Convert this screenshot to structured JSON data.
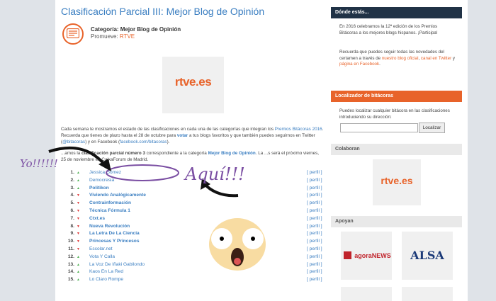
{
  "main": {
    "title": "Clasificación Parcial III: Mejor Blog de Opinión",
    "category_prefix": "Categoría:",
    "category": "Mejor Blog de Opinión",
    "promueve_prefix": "Promueve:",
    "promueve": "RTVE",
    "logo": "rtve.es",
    "intro_1": "Cada semana te mostramos el estado de las clasificaciones en cada una de las categorías que integran los",
    "intro_link": "Premios Bitácoras 2016",
    "intro_2": ". Recuerda que tienes de plazo hasta el 28 de octubre para",
    "intro_vote": "votar",
    "intro_3": "a tus blogs favoritos y que también puedes seguirnos en Twitter (",
    "intro_twitter": "@bitacoras",
    "intro_4": ") y en Facebook (",
    "intro_fb": "facebook.com/bitacoras",
    "intro_5": ").",
    "para2_1": "...amos la",
    "para2_bold": "clasificación parcial número 3",
    "para2_2": "correspondiente a la categoría",
    "para2_cat": "Mejor Blog de Opinión",
    "para2_3": ". La ...s será el próximo viernes, 25 de noviembre en CaixaForum de Madrid."
  },
  "ranking": [
    {
      "num": "1.",
      "trend": "up",
      "name": "Jessica Gómez",
      "bold": false
    },
    {
      "num": "2.",
      "trend": "up",
      "name": "Democresia",
      "bold": false
    },
    {
      "num": "3.",
      "trend": "up",
      "name": "Politikon",
      "bold": true
    },
    {
      "num": "4.",
      "trend": "down",
      "name": "Viviendo Analógicamente",
      "bold": true
    },
    {
      "num": "5.",
      "trend": "down",
      "name": "Contrainformación",
      "bold": true
    },
    {
      "num": "6.",
      "trend": "down",
      "name": "Técnica Fórmula 1",
      "bold": true
    },
    {
      "num": "7.",
      "trend": "down",
      "name": "Ctxt.es",
      "bold": true
    },
    {
      "num": "8.",
      "trend": "down",
      "name": "Nueva Revolución",
      "bold": true
    },
    {
      "num": "9.",
      "trend": "down",
      "name": "La Letra De La Ciencia",
      "bold": true
    },
    {
      "num": "10.",
      "trend": "down",
      "name": "Princesas Y Princesos",
      "bold": true
    },
    {
      "num": "11.",
      "trend": "down",
      "name": "Escolar.net",
      "bold": false
    },
    {
      "num": "12.",
      "trend": "up",
      "name": "Vota Y Calla",
      "bold": false
    },
    {
      "num": "13.",
      "trend": "up",
      "name": "La Voz De Iñaki Gabilondo",
      "bold": false
    },
    {
      "num": "14.",
      "trend": "up",
      "name": "Kaos En La Red",
      "bold": false
    },
    {
      "num": "15.",
      "trend": "up",
      "name": "Lo Claro Rompe",
      "bold": false
    }
  ],
  "perfil_label": "[ perfil ]",
  "annotations": {
    "yo": "Yo!!!!!!",
    "aqui": "Aquí!!!"
  },
  "sidebar": {
    "donde": {
      "title": "Dónde estás...",
      "text1": "En 2016 celebramos la 12ª edición de los Premios Bitácoras a los mejores blogs hispanos. ¡Participa!",
      "text2_1": "Recuerda que puedes seguir todas las novedades del certamen a través de",
      "link1": "nuestro blog oficial",
      "text2_2": ",",
      "link2": "canal en Twitter",
      "text2_3": "y",
      "link3": "página en Facebook",
      "text2_4": "."
    },
    "localizador": {
      "title": "Localizador de bitácoras",
      "text": "Puedes localizar cualquier bitácora en las clasificaciones introduciendo su dirección:",
      "button": "Localizar"
    },
    "colaboran": {
      "title": "Colaboran",
      "logo": "rtve.es"
    },
    "apoyan": {
      "title": "Apoyan",
      "logo1": "agoraNEWS",
      "logo2": "ALSA"
    }
  },
  "colors": {
    "accent": "#e8632a",
    "link": "#3a7ec1",
    "dark": "#203246",
    "annotation": "#7b4fa3"
  }
}
